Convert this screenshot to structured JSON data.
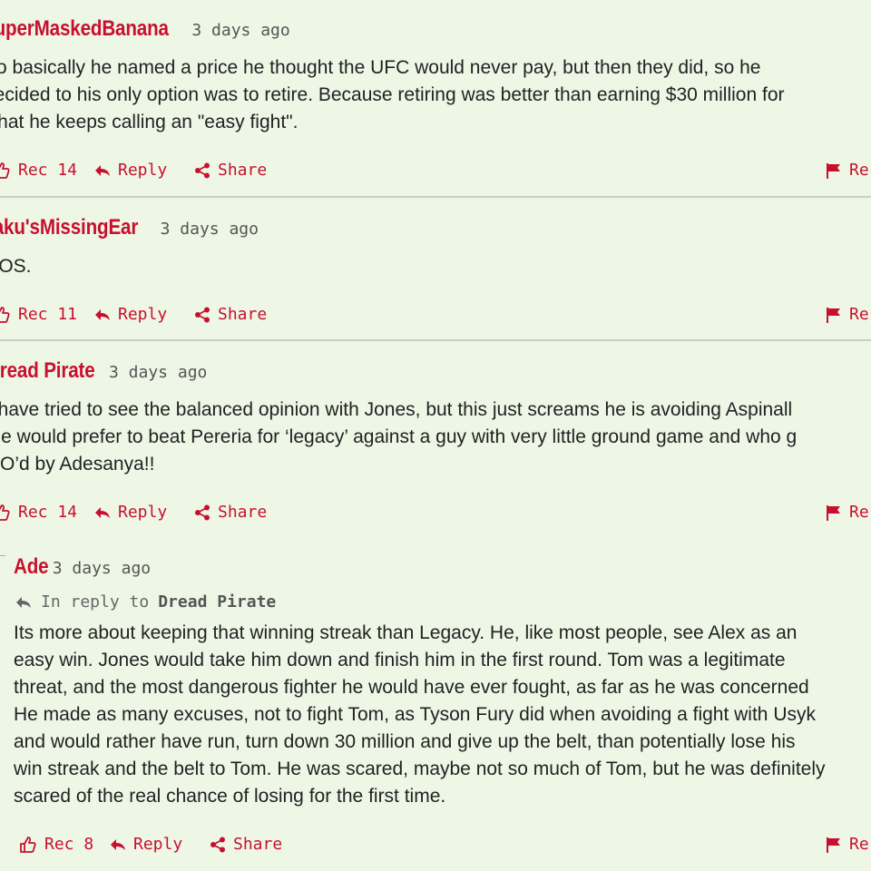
{
  "comments": [
    {
      "user": "SuperMaskedBanana",
      "time": "3 days ago",
      "lines": [
        "So basically he named a price he thought the UFC would never pay, but then they did, so he",
        "decided to his only option was to retire. Because retiring was better than earning $30 million for",
        "what he keeps calling an \"easy fight\"."
      ],
      "rec": "Rec 14",
      "reply": "Reply",
      "share": "Share",
      "report": "Re"
    },
    {
      "user": "Baku'sMissingEar",
      "time": "3 days ago",
      "lines": [
        "QOS."
      ],
      "rec": "Rec 11",
      "reply": "Reply",
      "share": "Share",
      "report": "Re"
    },
    {
      "user": "Dread Pirate",
      "time": "3 days ago",
      "lines": [
        "I have tried to see the balanced opinion with Jones, but this just screams he is avoiding Aspinall",
        "He would prefer to beat Pereria for ‘legacy’ against a guy with very little ground game and who g",
        "KO’d by Adesanya!!"
      ],
      "rec": "Rec 14",
      "reply": "Reply",
      "share": "Share",
      "report": "Re"
    },
    {
      "user": "Ade",
      "time": "3 days ago",
      "in_reply_to_prefix": "In reply to",
      "in_reply_to_user": "Dread Pirate",
      "lines": [
        "Its more about keeping that winning streak than Legacy. He, like most people, see Alex as an",
        "easy win. Jones would take him down and finish him in the first round. Tom was a legitimate",
        "threat, and the most dangerous fighter he would have ever fought, as far as he was concerned",
        "He made as many excuses, not to fight Tom, as Tyson Fury did when avoiding a fight with Usyk",
        "and would rather have run, turn down 30 million and give up the belt, than potentially lose his",
        "win streak and the belt to Tom. He was scared, maybe not so much of Tom, but he was definitely",
        "scared of the real chance of losing for the first time."
      ],
      "rec": "Rec 8",
      "reply": "Reply",
      "share": "Share",
      "report": "Re"
    }
  ]
}
